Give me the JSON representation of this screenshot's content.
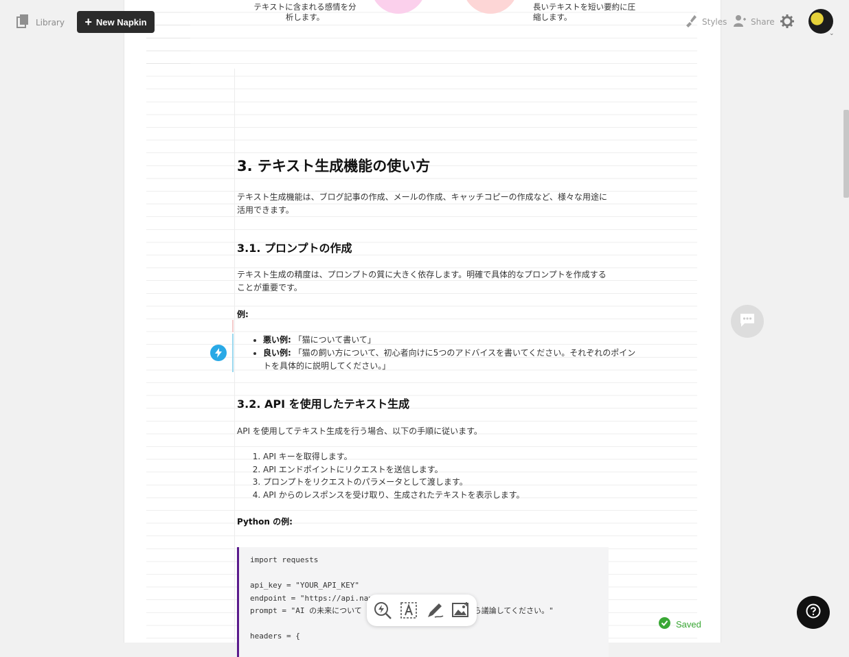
{
  "topbar": {
    "library_label": "Library",
    "new_button_label": "New Napkin",
    "styles_label": "Styles",
    "share_label": "Share"
  },
  "top_fragments": {
    "left_text": "テキストに含まれる感情を分\n析します。",
    "right_text": "長いテキストを短い要約に圧\n縮します。"
  },
  "document": {
    "h2": "3. テキスト生成機能の使い方",
    "intro": "テキスト生成機能は、ブログ記事の作成、メールの作成、キャッチコピーの作成など、様々な用途に活用できます。",
    "section1": {
      "title": "3.1. プロンプトの作成",
      "paragraph": "テキスト生成の精度は、プロンプトの質に大きく依存します。明確で具体的なプロンプトを作成することが重要です。",
      "example_label": "例:",
      "bullets": [
        {
          "label": "悪い例:",
          "text": "「猫について書いて」"
        },
        {
          "label": "良い例:",
          "text": "「猫の飼い方について、初心者向けに5つのアドバイスを書いてください。それぞれのポイントを具体的に説明してください。」"
        }
      ]
    },
    "section2": {
      "title": "3.2. API を使用したテキスト生成",
      "paragraph": "API を使用してテキスト生成を行う場合、以下の手順に従います。",
      "steps": [
        "API キーを取得します。",
        "API エンドポイントにリクエストを送信します。",
        "プロンプトをリクエストのパラメータとして渡します。",
        "API からのレスポンスを受け取り、生成されたテキストを表示します。"
      ],
      "code_label": "Python の例:",
      "code_lines": [
        "import requests",
        "",
        "api_key = \"YOUR_API_KEY\"",
        "endpoint = \"https://api.napl",
        "prompt = \"AI の未来について",
        "",
        "headers = {"
      ],
      "code_tail": "視点から議論してください。\""
    }
  },
  "status": {
    "saved_label": "Saved"
  },
  "colors": {
    "new_button_bg": "#2b2b2b",
    "code_border": "#5a1b8c",
    "saved_green": "#3aa835",
    "bolt_blue": "#29a9e6"
  },
  "icons": {
    "library": "library-icon",
    "styles": "styles-icon",
    "share": "share-icon",
    "settings": "gear-icon",
    "comment": "comment-icon",
    "help": "help-icon",
    "bolt": "bolt-icon",
    "toolbar": [
      "generate-visual-icon",
      "text-box-icon",
      "pen-icon",
      "image-icon"
    ]
  }
}
